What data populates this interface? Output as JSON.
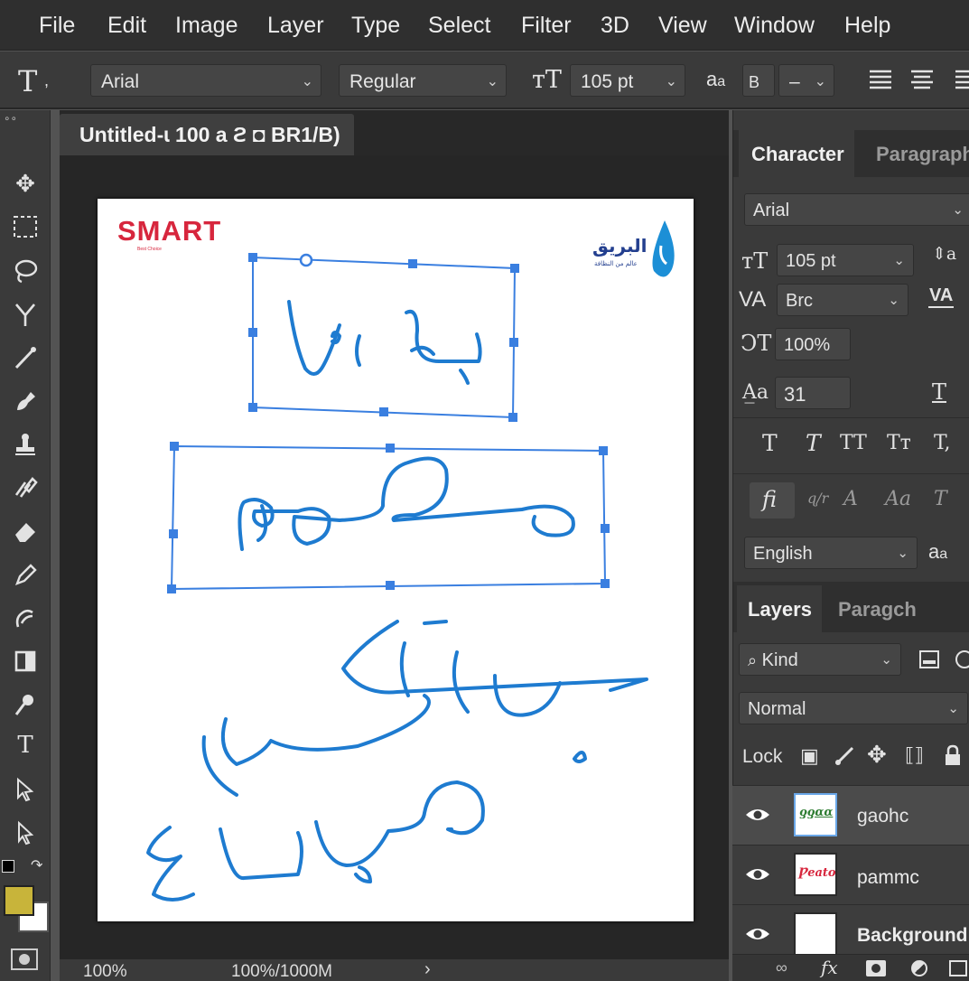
{
  "menu": [
    "File",
    "Edit",
    "Image",
    "Layer",
    "Type",
    "Select",
    "Filter",
    "3D",
    "View",
    "Window",
    "Help"
  ],
  "options": {
    "tool_glyph": "T",
    "font_family": "Arial",
    "font_style": "Regular",
    "font_size": "105 pt",
    "aa_label": "a",
    "aa_label_small": "a",
    "aa_mode": "B",
    "aa_extra": "–"
  },
  "document": {
    "tab_title": "Untitled-ɩ 100 a ϩ ◘ BR1/B)",
    "zoom": "100%",
    "doc_info": "100%/1000M",
    "logo_text": "SMART",
    "logo_sub": "Best Choice",
    "brand_ar": "البريق",
    "brand_ar_sub": "عالم من النظافة"
  },
  "character_panel": {
    "tab_character": "Character",
    "tab_paragraph": "Paragraph",
    "font_family": "Arial",
    "font_size": "105 pt",
    "kerning_label": "VA",
    "kerning_value": "Brc",
    "tracking_label": "VA",
    "vscale": "100%",
    "baseline": "31",
    "language": "English",
    "aa_label": "a"
  },
  "layers_panel": {
    "tab_layers": "Layers",
    "tab_other": "Paragch",
    "filter_kind": "Kind",
    "blend_mode": "Normal",
    "lock_label": "Lock",
    "layers": [
      {
        "name": "gaohc",
        "thumb_text": "ƍƍɑɑ",
        "selected": true
      },
      {
        "name": "pammc",
        "thumb_text": "Ƿeato",
        "selected": false
      },
      {
        "name": "Background",
        "thumb_text": "",
        "selected": false
      }
    ]
  },
  "colors": {
    "foreground": "#c8b43a",
    "background": "#ffffff",
    "stroke_blue": "#1e7bd0",
    "handle_blue": "#3a7fe0",
    "smart_red": "#d7263d"
  }
}
